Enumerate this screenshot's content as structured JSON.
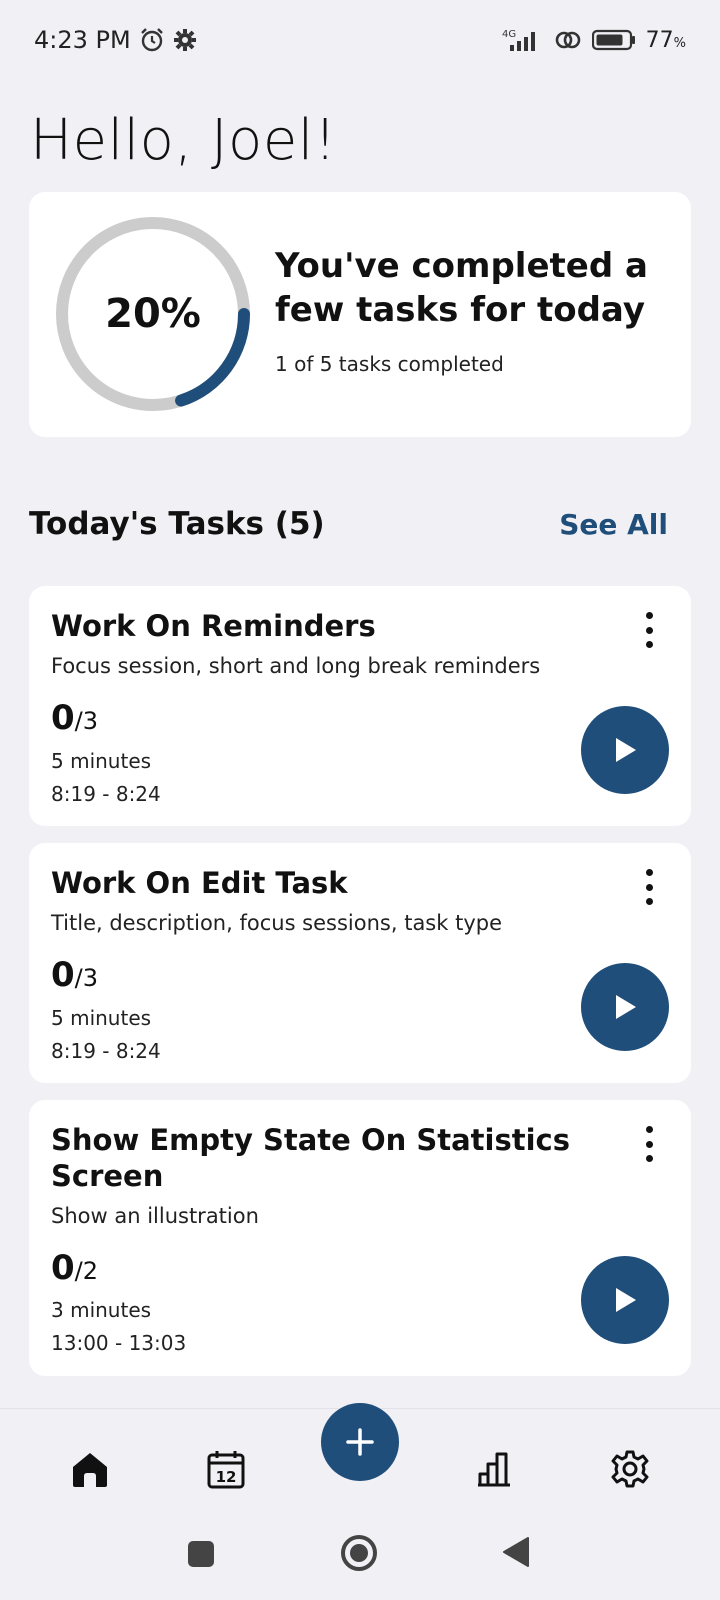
{
  "status_bar": {
    "time": "4:23 PM",
    "alarm_icon": "alarm-clock-icon",
    "settings_icon": "gear-icon",
    "network": "4G",
    "battery_percent": "77",
    "battery_unit": "%"
  },
  "greeting": "Hello, Joel!",
  "progress": {
    "percent_label": "20%",
    "fraction": 0.2,
    "headline": "You've completed a few tasks for today",
    "subtitle": "1 of 5 tasks completed",
    "ring_color": "#1f4e7a",
    "track_color": "#cccccc"
  },
  "tasks_section": {
    "title": "Today's Tasks (5)",
    "see_all": "See All"
  },
  "tasks": [
    {
      "title": "Work On Reminders",
      "description": "Focus session, short and long break reminders",
      "done": "0",
      "total": "/3",
      "duration": "5 minutes",
      "time_range": "8:19 - 8:24"
    },
    {
      "title": "Work On Edit Task",
      "description": "Title, description, focus sessions, task type",
      "done": "0",
      "total": "/3",
      "duration": "5 minutes",
      "time_range": "8:19 - 8:24"
    },
    {
      "title": "Show Empty State On Statistics Screen",
      "description": "Show an illustration",
      "done": "0",
      "total": "/2",
      "duration": "3 minutes",
      "time_range": "13:00 - 13:03"
    }
  ],
  "bottom_nav": {
    "items": [
      "home-icon",
      "calendar-icon",
      "add-icon",
      "statistics-icon",
      "settings-icon"
    ],
    "calendar_day": "12"
  },
  "colors": {
    "accent": "#1f4e7a",
    "background": "#f1f0f5"
  }
}
